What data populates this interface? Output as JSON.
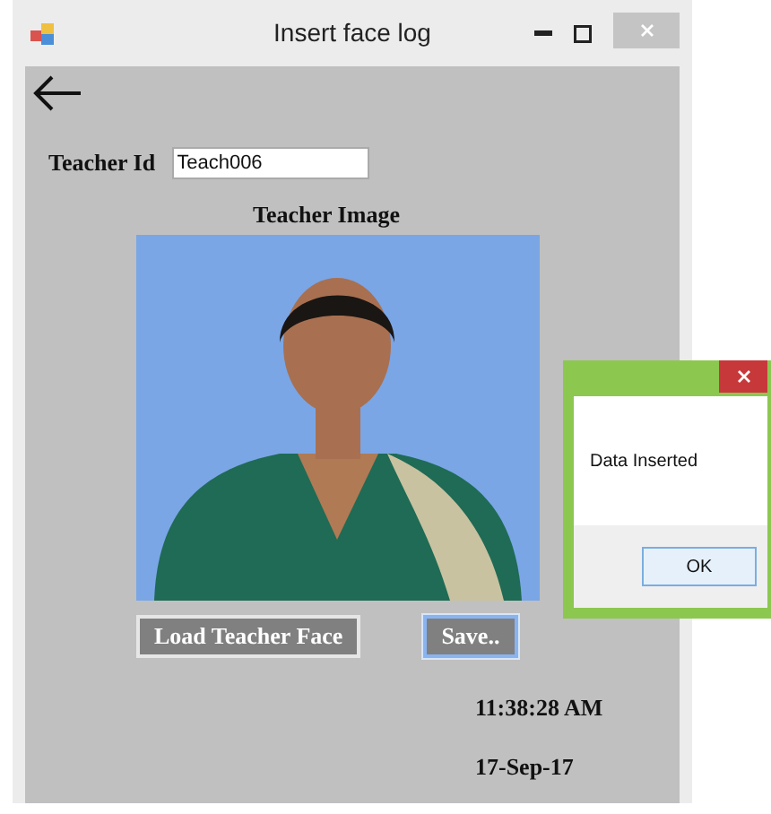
{
  "window": {
    "title": "Insert face log"
  },
  "teacher_id": {
    "label": "Teacher Id",
    "value": "Teach006"
  },
  "image": {
    "title": "Teacher Image"
  },
  "buttons": [
    {
      "label": "Load Teacher Face",
      "focused": false
    },
    {
      "label": "Save..",
      "focused": true
    }
  ],
  "time": "11:38:28 AM",
  "date": "17-Sep-17",
  "dialog": {
    "message": "Data Inserted",
    "button": "OK"
  }
}
